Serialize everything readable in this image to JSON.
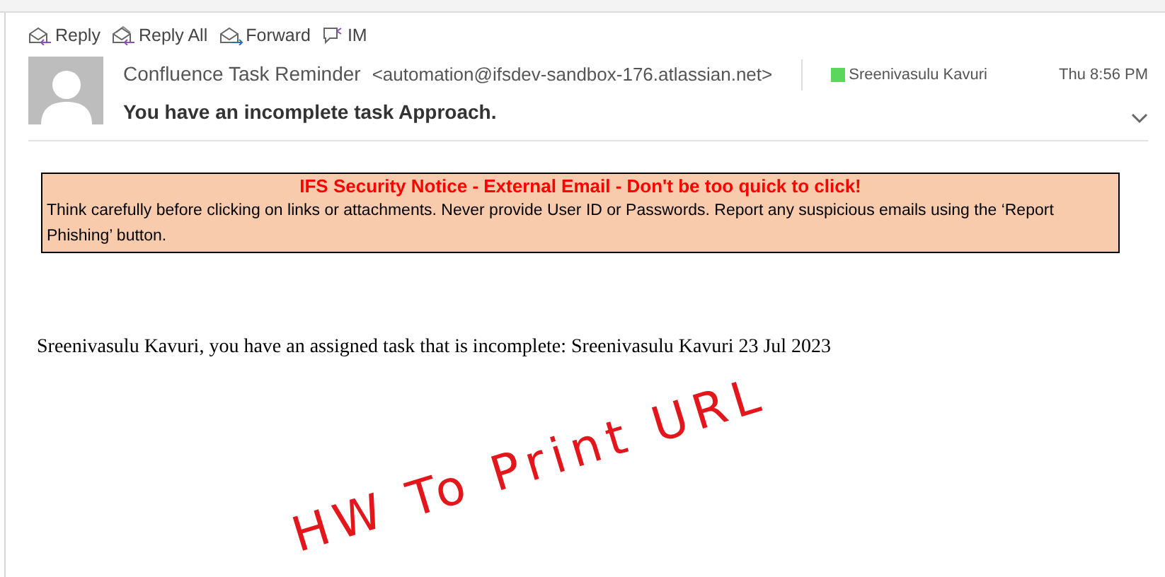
{
  "toolbar": [
    {
      "kind": "reply",
      "label": "Reply"
    },
    {
      "kind": "reply_all",
      "label": "Reply All"
    },
    {
      "kind": "forward",
      "label": "Forward"
    },
    {
      "kind": "im",
      "label": "IM"
    }
  ],
  "header": {
    "sender": "Confluence Task Reminder",
    "address": "<automation@ifsdev-sandbox-176.atlassian.net>",
    "recipient": {
      "name": "Sreenivasulu Kavuri",
      "color": "#5cd65c"
    },
    "time": "Thu 8:56 PM",
    "subject": "You have an incomplete task Approach."
  },
  "notice": {
    "title": "IFS Security Notice - External Email - Don't be too quick to click!",
    "text": "Think carefully before clicking on links or attachments. Never provide User ID or Passwords. Report any suspicious emails using the ‘Report Phishing’ button."
  },
  "body": "Sreenivasulu Kavuri, you have an assigned task that is incomplete: Sreenivasulu Kavuri 23 Jul 2023",
  "annotation": "HW To Print URL"
}
